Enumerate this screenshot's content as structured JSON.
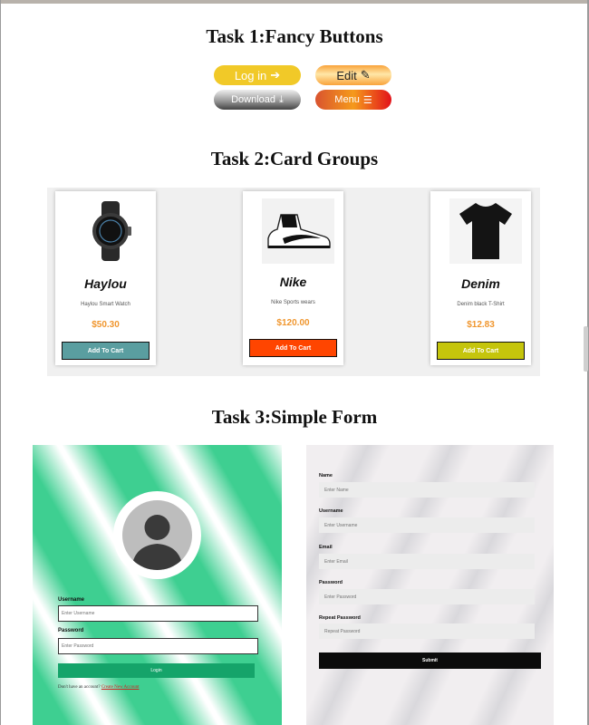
{
  "task1": {
    "title": "Task 1:Fancy Buttons",
    "buttons": [
      {
        "label": "Log in",
        "icon": "arrow-right-icon"
      },
      {
        "label": "Edit",
        "icon": "pencil-icon"
      },
      {
        "label": "Download",
        "icon": "download-icon"
      },
      {
        "label": "Menu",
        "icon": "menu-icon"
      }
    ]
  },
  "task2": {
    "title": "Task 2:Card Groups",
    "cards": [
      {
        "name": "Haylou",
        "desc": "Haylou Smart Watch",
        "price": "$50.30",
        "cart": "Add To Cart",
        "cart_color": "#5a9ea0"
      },
      {
        "name": "Nike",
        "desc": "Nike Sports wears",
        "price": "$120.00",
        "cart": "Add To Cart",
        "cart_color": "#ff4500"
      },
      {
        "name": "Denim",
        "desc": "Denim black T-Shirt",
        "price": "$12.83",
        "cart": "Add To Cart",
        "cart_color": "#c5c50c"
      }
    ]
  },
  "task3": {
    "title": "Task 3:Simple Form",
    "login": {
      "username_label": "Username",
      "username_placeholder": "Enter Username",
      "password_label": "Password",
      "password_placeholder": "Enter Password",
      "submit": "Login",
      "no_account": "Don't have an account?",
      "signup_link": "Create New Account"
    },
    "register": {
      "fields": [
        {
          "label": "Name",
          "placeholder": "Enter Name"
        },
        {
          "label": "Username",
          "placeholder": "Enter Username"
        },
        {
          "label": "Email",
          "placeholder": "Enter Email"
        },
        {
          "label": "Password",
          "placeholder": "Enter Password"
        },
        {
          "label": "Repeat Password",
          "placeholder": "Repeat Password"
        }
      ],
      "submit": "Submit"
    }
  },
  "colors": {
    "price": "#f0962e",
    "login_green": "#3ecf91"
  }
}
